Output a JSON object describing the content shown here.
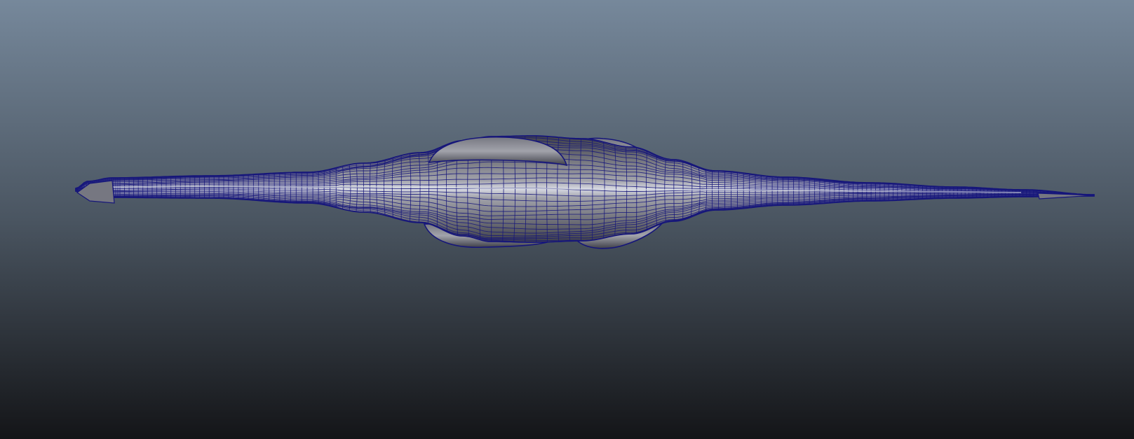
{
  "viewport": {
    "background_top": "#76889b",
    "background_mid": "#4a5561",
    "background_bottom": "#141518"
  },
  "mesh": {
    "object": "polygon-mesh-creature",
    "wire_color": "#16167a",
    "surface_light": "#a2a3ab",
    "surface_mid": "#767781",
    "surface_dark": "#3f4049",
    "highlight": "#d6d8e2"
  }
}
